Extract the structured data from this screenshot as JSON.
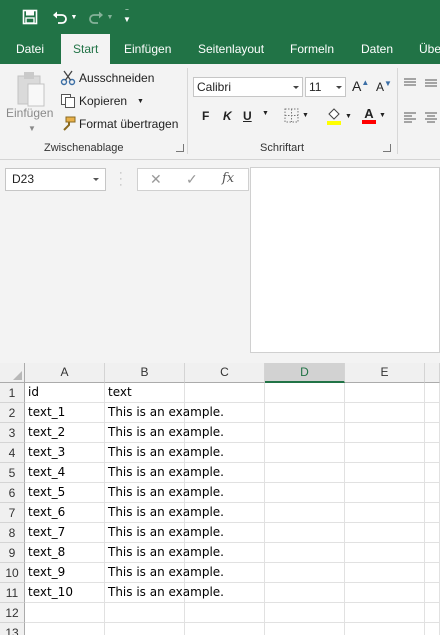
{
  "quick_access": {
    "save_icon": "save-icon",
    "undo_icon": "undo-icon",
    "redo_icon": "redo-icon",
    "customize_icon": "customize-qat-icon"
  },
  "tabs": [
    "Datei",
    "Start",
    "Einfügen",
    "Seitenlayout",
    "Formeln",
    "Daten",
    "Über"
  ],
  "active_tab": "Start",
  "clipboard": {
    "paste_label": "Einfügen",
    "cut_label": "Ausschneiden",
    "copy_label": "Kopieren",
    "format_painter_label": "Format übertragen",
    "group_label": "Zwischenablage"
  },
  "font": {
    "font_name": "Calibri",
    "font_size": "11",
    "grow_label": "A",
    "shrink_label": "A",
    "bold_label": "F",
    "italic_label": "K",
    "underline_label": "U",
    "font_color_label": "A",
    "group_label": "Schriftart"
  },
  "colors": {
    "accent": "#217346",
    "highlight": "#ffff00",
    "font_color": "#ff0000"
  },
  "formula_bar": {
    "name_box": "D23",
    "cancel_label": "✕",
    "enter_label": "✓",
    "fx_label": "fx",
    "content": ""
  },
  "sheet": {
    "columns": [
      "A",
      "B",
      "C",
      "D",
      "E"
    ],
    "selected_column": "D",
    "row_numbers": [
      "1",
      "2",
      "3",
      "4",
      "5",
      "6",
      "7",
      "8",
      "9",
      "10",
      "11",
      "12",
      "13"
    ],
    "rows": [
      [
        "id",
        "text"
      ],
      [
        "text_1",
        "This is an example."
      ],
      [
        "text_2",
        "This is an example."
      ],
      [
        "text_3",
        "This is an example."
      ],
      [
        "text_4",
        "This is an example."
      ],
      [
        "text_5",
        "This is an example."
      ],
      [
        "text_6",
        "This is an example."
      ],
      [
        "text_7",
        "This is an example."
      ],
      [
        "text_8",
        "This is an example."
      ],
      [
        "text_9",
        "This is an example."
      ],
      [
        "text_10",
        "This is an example."
      ],
      [
        "",
        ""
      ],
      [
        "",
        ""
      ]
    ]
  }
}
